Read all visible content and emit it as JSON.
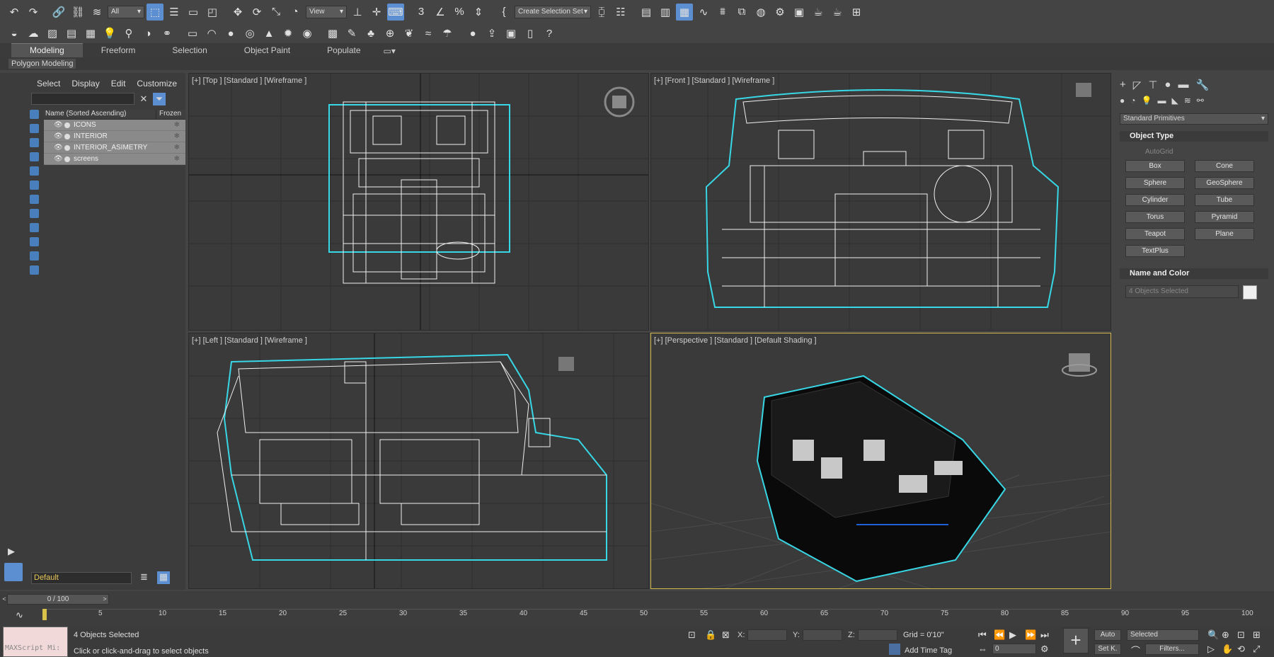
{
  "toolbar": {
    "filter_value": "All",
    "view_value": "View",
    "selection_set_placeholder": "Create Selection Set"
  },
  "ribbon": {
    "tabs": [
      "Modeling",
      "Freeform",
      "Selection",
      "Object Paint",
      "Populate"
    ],
    "sub_label": "Polygon Modeling"
  },
  "scene_explorer": {
    "menu": [
      "Select",
      "Display",
      "Edit",
      "Customize"
    ],
    "col_name": "Name (Sorted Ascending)",
    "col_frozen": "Frozen",
    "rows": [
      "ICONS",
      "INTERIOR",
      "INTERIOR_ASIMETRY",
      "screens"
    ],
    "layer": "Default"
  },
  "viewports": {
    "top": "[+] [Top ] [Standard ] [Wireframe ]",
    "front": "[+] [Front ] [Standard ] [Wireframe ]",
    "left": "[+] [Left ] [Standard ] [Wireframe ]",
    "perspective": "[+] [Perspective ] [Standard ] [Default Shading ]"
  },
  "command_panel": {
    "category": "Standard Primitives",
    "object_type_title": "Object Type",
    "autogrid": "AutoGrid",
    "buttons": [
      "Box",
      "Cone",
      "Sphere",
      "GeoSphere",
      "Cylinder",
      "Tube",
      "Torus",
      "Pyramid",
      "Teapot",
      "Plane",
      "TextPlus"
    ],
    "name_color_title": "Name and Color",
    "name_value": "4 Objects Selected"
  },
  "timeline": {
    "slider": "0 / 100",
    "ticks": [
      "5",
      "10",
      "15",
      "20",
      "25",
      "30",
      "35",
      "40",
      "45",
      "50",
      "55",
      "60",
      "65",
      "70",
      "75",
      "80",
      "85",
      "90",
      "95",
      "100"
    ]
  },
  "status": {
    "maxscript": "MAXScript Mi:",
    "selected": "4 Objects Selected",
    "prompt": "Click or click-and-drag to select objects",
    "x_label": "X:",
    "y_label": "Y:",
    "z_label": "Z:",
    "grid": "Grid = 0'10\"",
    "add_time_tag": "Add Time Tag",
    "auto": "Auto",
    "setk": "Set K.",
    "selected_mode": "Selected",
    "frame": "0",
    "filters": "Filters..."
  }
}
